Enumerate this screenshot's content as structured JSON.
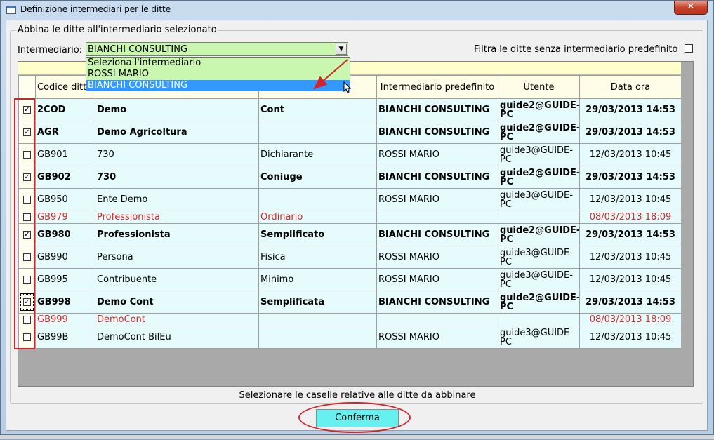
{
  "window": {
    "title": "Definizione intermediari per le ditte",
    "close_label": "✕"
  },
  "group": {
    "legend": "Abbina le ditte all'intermediario selezionato"
  },
  "intermediario": {
    "label": "Intermediario:",
    "value": "BIANCHI CONSULTING",
    "options": [
      "Seleziona l'intermediario",
      "ROSSI MARIO",
      "BIANCHI CONSULTING"
    ],
    "selected_index": 2
  },
  "filtro": {
    "label": "Filtra le ditte senza intermediario predefinito",
    "checked": false
  },
  "table": {
    "headers": [
      "",
      "Codice ditta",
      "",
      "",
      "Intermediario predefinito",
      "Utente",
      "Data ora"
    ],
    "rows": [
      {
        "checked": true,
        "codice": "2COD",
        "ragione": "Demo",
        "tipo": "Cont",
        "intermediario": "BIANCHI CONSULTING",
        "utente": "guide2@GUIDE-PC",
        "data": "29/03/2013 14:53",
        "style": "bold"
      },
      {
        "checked": true,
        "codice": "AGR",
        "ragione": "Demo Agricoltura",
        "tipo": "",
        "intermediario": "BIANCHI CONSULTING",
        "utente": "guide2@GUIDE-PC",
        "data": "29/03/2013 14:53",
        "style": "bold"
      },
      {
        "checked": false,
        "codice": "GB901",
        "ragione": "730",
        "tipo": "Dichiarante",
        "intermediario": "ROSSI MARIO",
        "utente": "guide3@GUIDE-PC",
        "data": "12/03/2013 10:45",
        "style": "normal"
      },
      {
        "checked": true,
        "codice": "GB902",
        "ragione": "730",
        "tipo": "Coniuge",
        "intermediario": "BIANCHI CONSULTING",
        "utente": "guide2@GUIDE-PC",
        "data": "29/03/2013 14:53",
        "style": "bold"
      },
      {
        "checked": false,
        "codice": "GB950",
        "ragione": "Ente Demo",
        "tipo": "",
        "intermediario": "ROSSI MARIO",
        "utente": "guide3@GUIDE-PC",
        "data": "12/03/2013 10:45",
        "style": "normal"
      },
      {
        "checked": false,
        "codice": "GB979",
        "ragione": "Professionista",
        "tipo": "Ordinario",
        "intermediario": "",
        "utente": "",
        "data": "08/03/2013 18:09",
        "style": "red"
      },
      {
        "checked": true,
        "codice": "GB980",
        "ragione": "Professionista",
        "tipo": "Semplificato",
        "intermediario": "BIANCHI CONSULTING",
        "utente": "guide2@GUIDE-PC",
        "data": "29/03/2013 14:53",
        "style": "bold"
      },
      {
        "checked": false,
        "codice": "GB990",
        "ragione": "Persona",
        "tipo": "Fisica",
        "intermediario": "ROSSI MARIO",
        "utente": "guide3@GUIDE-PC",
        "data": "12/03/2013 10:45",
        "style": "normal"
      },
      {
        "checked": false,
        "codice": "GB995",
        "ragione": "Contribuente",
        "tipo": "Minimo",
        "intermediario": "ROSSI MARIO",
        "utente": "guide3@GUIDE-PC",
        "data": "12/03/2013 10:45",
        "style": "normal"
      },
      {
        "checked": true,
        "codice": "GB998",
        "ragione": "Demo Cont",
        "tipo": "Semplificata",
        "intermediario": "BIANCHI CONSULTING",
        "utente": "guide2@GUIDE-PC",
        "data": "29/03/2013 14:53",
        "style": "bold",
        "focused": true
      },
      {
        "checked": false,
        "codice": "GB999",
        "ragione": "DemoCont",
        "tipo": "",
        "intermediario": "",
        "utente": "",
        "data": "08/03/2013 18:09",
        "style": "red"
      },
      {
        "checked": false,
        "codice": "GB99B",
        "ragione": "DemoCont BilEu",
        "tipo": "",
        "intermediario": "ROSSI MARIO",
        "utente": "guide3@GUIDE-PC",
        "data": "12/03/2013 10:45",
        "style": "normal"
      }
    ]
  },
  "hint": "Selezionare le caselle relative alle ditte da abbinare",
  "confirm_label": "Conferma",
  "colors": {
    "combo_bg": "#c9f7b0",
    "row_bg": "#e6fcfc",
    "red_text": "#d02b2b",
    "annotation": "#d4242b",
    "confirm_bg": "#66f0f0",
    "selection": "#3399ff"
  }
}
